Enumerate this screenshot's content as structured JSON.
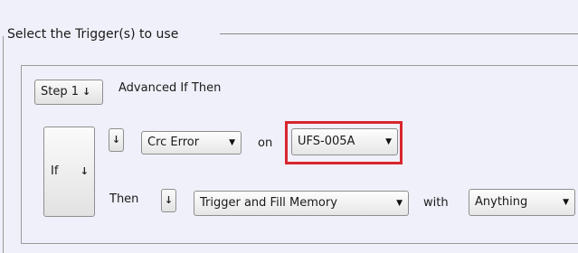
{
  "group": {
    "title": "Select the Trigger(s) to use"
  },
  "step": {
    "label": "Step 1",
    "description": "Advanced If Then"
  },
  "if_block": {
    "label": "If"
  },
  "if_row": {
    "event": "Crc Error",
    "on_label": "on",
    "device": "UFS-005A"
  },
  "then_row": {
    "then_label": "Then",
    "action": "Trigger and Fill Memory",
    "with_label": "with",
    "match": "Anything"
  },
  "colors": {
    "highlight": "#d8262c",
    "background": "#f0f0fb"
  },
  "icons": {
    "expand": "double-chevron-down-icon",
    "dropdown": "dropdown-arrow-icon"
  }
}
